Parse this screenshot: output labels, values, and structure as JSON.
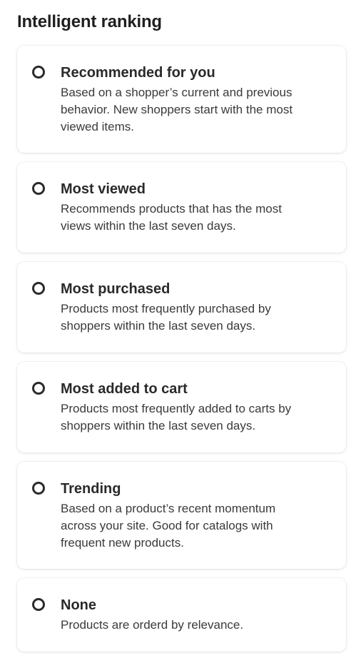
{
  "header": {
    "title": "Intelligent ranking"
  },
  "options": [
    {
      "title": "Recommended for you",
      "description": "Based on a shopper’s current and previous behavior. New shoppers start with the most viewed items."
    },
    {
      "title": "Most viewed",
      "description": "Recommends products that has the most views within the last seven days."
    },
    {
      "title": "Most purchased",
      "description": "Products most frequently purchased by shoppers within the last seven days."
    },
    {
      "title": "Most added to cart",
      "description": "Products most frequently added to carts by shoppers within the last seven days."
    },
    {
      "title": "Trending",
      "description": "Based on a product’s recent momentum across your site. Good for catalogs with frequent new products."
    },
    {
      "title": "None",
      "description": "Products are orderd by relevance."
    }
  ]
}
